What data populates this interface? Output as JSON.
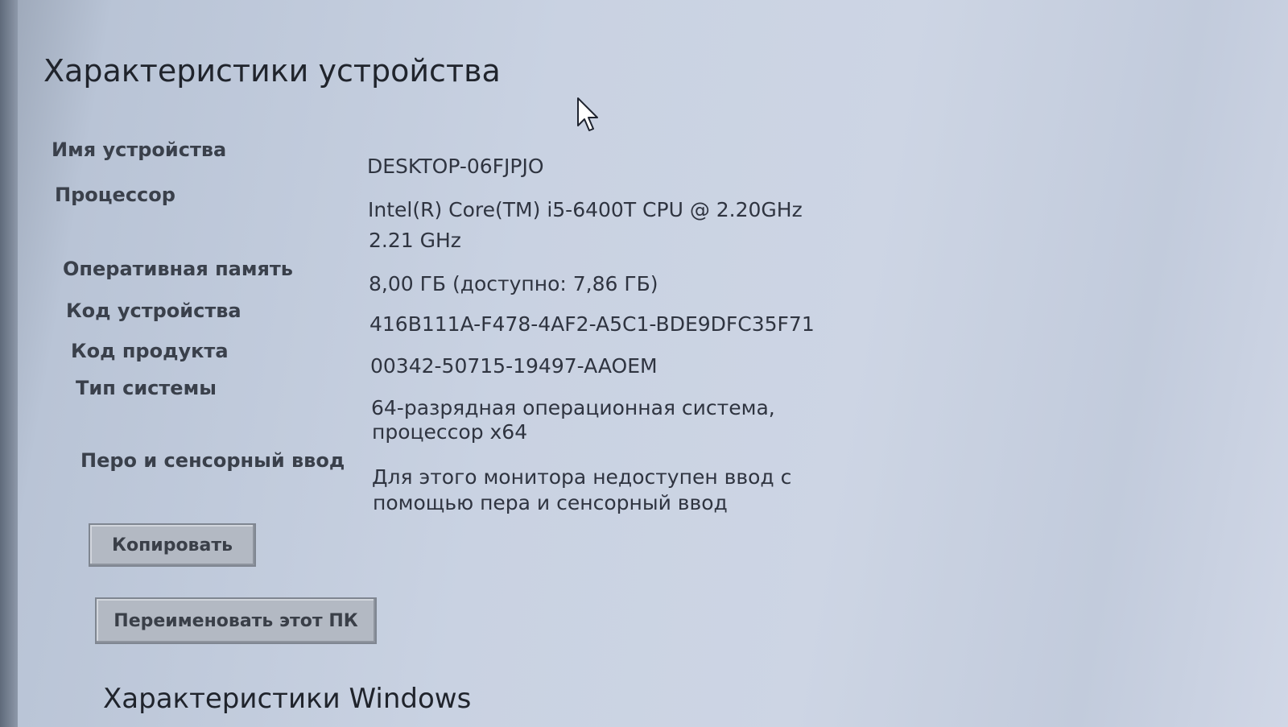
{
  "title": "Характеристики устройства",
  "specs": [
    {
      "label": "Имя устройства",
      "value": "DESKTOP-06FJPJO",
      "value2": ""
    },
    {
      "label": "Процессор",
      "value": "Intel(R) Core(TM) i5-6400T CPU @ 2.20GHz",
      "value2": "2.21 GHz"
    },
    {
      "label": "Оперативная память",
      "value": "8,00 ГБ (доступно: 7,86 ГБ)",
      "value2": ""
    },
    {
      "label": "Код устройства",
      "value": "416B111A-F478-4AF2-A5C1-BDE9DFC35F71",
      "value2": ""
    },
    {
      "label": "Код продукта",
      "value": "00342-50715-19497-AAOEM",
      "value2": ""
    },
    {
      "label": "Тип системы",
      "value": "64-разрядная операционная система,",
      "value2": "процессор x64"
    },
    {
      "label": "Перо и сенсорный ввод",
      "value": "Для этого монитора недоступен ввод с",
      "value2": "помощью пера и сенсорный ввод"
    }
  ],
  "buttons": {
    "copy": "Копировать",
    "rename": "Переименовать этот ПК"
  },
  "next_section_title": "Характеристики Windows"
}
